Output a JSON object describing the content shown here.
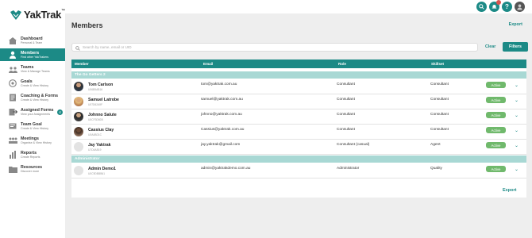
{
  "app": {
    "logo_text": "YakTrak",
    "logo_tm": "™"
  },
  "topbar": {
    "icons": [
      "search-icon",
      "notifications-icon",
      "help-icon",
      "user-avatar"
    ],
    "help_glyph": "?"
  },
  "sidebar": {
    "items": [
      {
        "label": "Dashboard",
        "sub": "Personal & Team"
      },
      {
        "label": "Members",
        "sub": "Find other YakTrakers"
      },
      {
        "label": "Teams",
        "sub": "View & Manage Teams"
      },
      {
        "label": "Goals",
        "sub": "Create & View History"
      },
      {
        "label": "Coaching & Forms",
        "sub": "Create & View History"
      },
      {
        "label": "Assigned Forms",
        "sub": "View your Assignments",
        "badge": "4"
      },
      {
        "label": "Team Goal",
        "sub": "Create & View History"
      },
      {
        "label": "Meetings",
        "sub": "Organise & View History"
      },
      {
        "label": "Reports",
        "sub": "Create Reports"
      },
      {
        "label": "Resources",
        "sub": "Discover more"
      }
    ]
  },
  "page": {
    "title": "Members",
    "export_label": "Export"
  },
  "search": {
    "placeholder": "Search by name, email or UID",
    "clear_label": "Clear",
    "filters_label": "Filters"
  },
  "table": {
    "headers": [
      "Member",
      "Email",
      "Role",
      "Skillset"
    ],
    "groups": [
      {
        "name": "The Go Getters 2",
        "rows": [
          {
            "name": "Tom Carlson",
            "uid": "U06B5AB16",
            "email": "tom@yaktrak.com.au",
            "role": "Consultant",
            "skillset": "Consultant",
            "status": "Active"
          },
          {
            "name": "Samuel Latrobe",
            "uid": "U07D62A9F",
            "email": "samuel@yaktrak.com.au",
            "role": "Consultant",
            "skillset": "Consultant",
            "status": "Active"
          },
          {
            "name": "Johnno Salute",
            "uid": "U0CF3D6D5",
            "email": "johnno@yaktrak.com.au",
            "role": "Consultant",
            "skillset": "Consultant",
            "status": "Active"
          },
          {
            "name": "Cassius Clay",
            "uid": "U0A4BD1C",
            "email": "Cassius@yaktrak.com.au",
            "role": "Consultant",
            "skillset": "Consultant",
            "status": "Active"
          },
          {
            "name": "Jay Yaktrak",
            "uid": "U7D4AB19",
            "email": "jay.yaktrak@gmail.com",
            "role": "Consultant (casual)",
            "skillset": "Agent",
            "status": "Active"
          }
        ]
      },
      {
        "name": "Administrator",
        "rows": [
          {
            "name": "Admin Demo1",
            "uid": "U0C9DBBB61",
            "email": "admin@yaktrakdemo.com.au",
            "role": "Administrator",
            "skillset": "Quality",
            "status": "Active"
          }
        ]
      }
    ],
    "row_action_icon": "chevron-down-icon",
    "chevron_glyph": "⌄"
  },
  "footer": {
    "export_label": "Export"
  },
  "colors": {
    "accent": "#1c8a86",
    "group_bg": "#a8d8d4",
    "active_badge": "#70b96c"
  }
}
